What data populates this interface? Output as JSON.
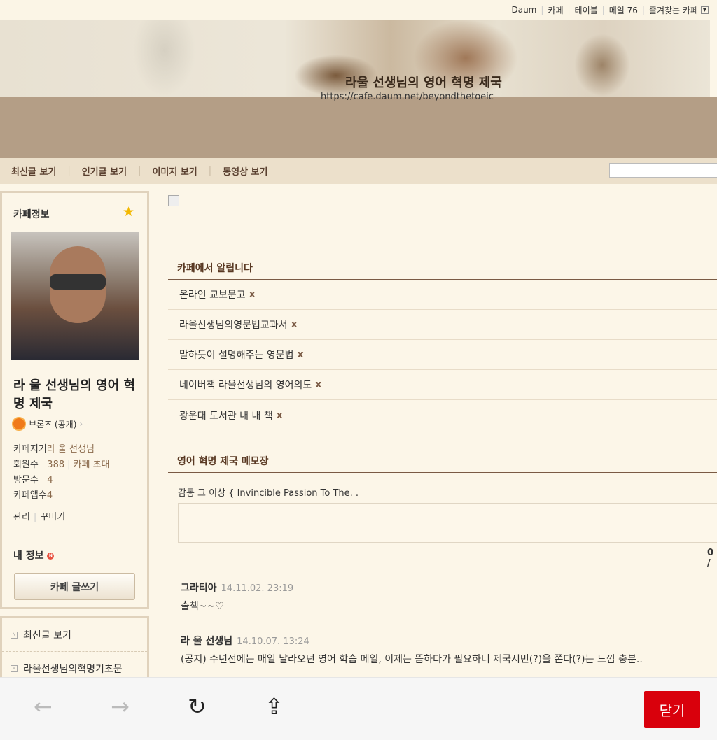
{
  "topbar": {
    "links": [
      "Daum",
      "카페",
      "테이블",
      "메일 76",
      "즐겨찾는 카페"
    ]
  },
  "banner": {
    "title": "라울 선생님의 영어 혁명 제국",
    "url": "https://cafe.daum.net/beyondthetoeic"
  },
  "nav": {
    "items": [
      "최신글 보기",
      "인기글 보기",
      "이미지 보기",
      "동영상 보기"
    ]
  },
  "sidebar": {
    "heading": "카페정보",
    "cafe_name": "라 울 선생님의 영어 혁명 제국",
    "grade": "브론즈 (공개)",
    "manager_label": "카페지기",
    "manager": "라 울 선생님",
    "members_label": "회원수",
    "members": "388",
    "invite": "카페 초대",
    "visits_label": "방문수",
    "visits": "4",
    "app_label": "카페앱수",
    "app": "4",
    "manage": "관리",
    "decorate": "꾸미기",
    "myinfo": "내 정보",
    "write": "카페 글쓰기",
    "menu": [
      "최신글 보기",
      "라울선생님의혁명기초문"
    ]
  },
  "notice": {
    "title": "카페에서 알립니다",
    "items": [
      "온라인 교보문고",
      "라울선생님의영문법교과서",
      "말하듯이 설명해주는 영문법",
      "네이버책 라울선생님의 영어의도",
      "광운대 도서관 내 내 책"
    ],
    "x": "x"
  },
  "memo": {
    "title": "영어 혁명 제국 메모장",
    "intro": "감동 그 이상 { Invincible Passion To The. .",
    "count": "0 /",
    "comments": [
      {
        "author": "그라티아",
        "time": "14.11.02. 23:19",
        "body": "출첵~~♡"
      },
      {
        "author": "라 울 선생님",
        "time": "14.10.07. 13:24",
        "body": "(공지) 수년전에는 매일 날라오던 영어 학습 메일, 이제는 뜸하다가 필요하니 제국시민(?)을 쫀다(?)는 느낌 충분.."
      }
    ]
  },
  "browser": {
    "close": "닫기"
  }
}
